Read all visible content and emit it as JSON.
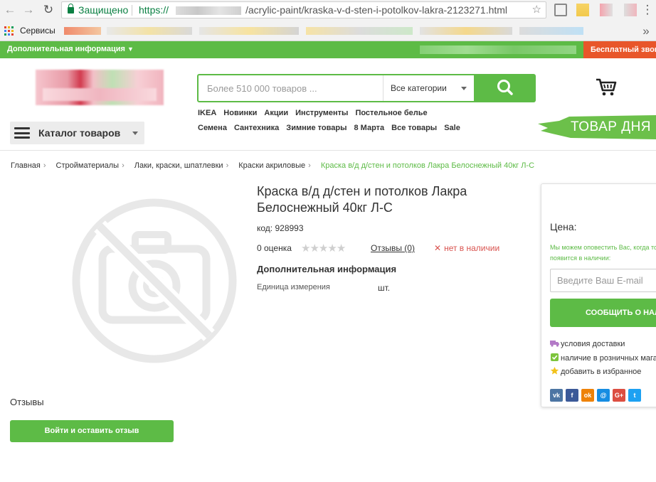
{
  "browser": {
    "security_label": "Защищено",
    "url_protocol": "https://",
    "url_path": "/acrylic-paint/kraska-v-d-sten-i-potolkov-lakra-2123271.html",
    "bookmarks_label": "Сервисы"
  },
  "topbar": {
    "info_label": "Дополнительная информация",
    "callback_label": "Бесплатный звонок"
  },
  "search": {
    "placeholder": "Более 510 000 товаров ...",
    "category": "Все категории"
  },
  "quicklinks_row1": [
    "IKEA",
    "Новинки",
    "Акции",
    "Инструменты",
    "Постельное белье"
  ],
  "quicklinks_row2": [
    "Семена",
    "Сантехника",
    "Зимние товары",
    "8 Марта",
    "Все товары",
    "Sale"
  ],
  "catalog_label": "Каталог товаров",
  "deal_label": "ТОВАР ДНЯ",
  "breadcrumb": [
    "Главная",
    "Стройматериалы",
    "Лаки, краски, шпатлевки",
    "Краски акриловые"
  ],
  "breadcrumb_current": "Краска в/д д/стен и потолков Лакра Белоснежный 40кг Л-С",
  "product": {
    "title": "Краска в/д д/стен и потолков Лакра Белоснежный 40кг Л-С",
    "code": "код: 928993",
    "rating_text": "0 оценка",
    "stars_filled": 0,
    "stars_total": 5,
    "reviews_link": "Отзывы (0)",
    "stock_status": "нет в наличии",
    "additional_info_heading": "Дополнительная информация",
    "unit_label": "Единица измерения",
    "unit_value": "шт."
  },
  "panel": {
    "price_label": "Цена:",
    "notify_text": "Мы можем оповестить Вас, когда товар появится в наличии:",
    "email_placeholder": "Введите Ваш E-mail",
    "notify_button": "СООБЩИТЬ О НАЛИЧИИ",
    "perks": [
      "условия доставки",
      "наличие в розничных магазинах",
      "добавить в избранное"
    ],
    "socials": [
      "vk",
      "fb",
      "ok",
      "mm",
      "G+",
      "tw"
    ]
  },
  "reviews": {
    "heading": "Отзывы",
    "button": "Войти и оставить отзыв"
  },
  "colors": {
    "brand_green": "#5dbb46",
    "callback_orange": "#e8562a",
    "out_of_stock_red": "#d9534f"
  }
}
